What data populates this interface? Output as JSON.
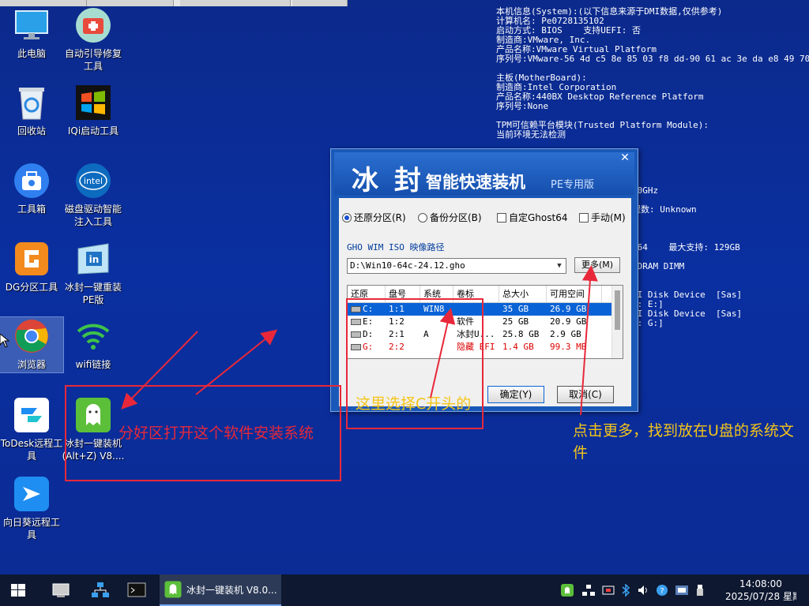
{
  "desktop_icons": [
    {
      "label": "此电脑",
      "icon": "computer-icon"
    },
    {
      "label": "自动引导修复工具",
      "icon": "repair-kit-icon"
    },
    {
      "label": "回收站",
      "icon": "recycle-bin-icon"
    },
    {
      "label": "IQi启动工具",
      "icon": "windows-logo-icon"
    },
    {
      "label": "工具箱",
      "icon": "toolbox-icon"
    },
    {
      "label": "磁盘驱动智能注入工具",
      "icon": "intel-icon"
    },
    {
      "label": "DG分区工具",
      "icon": "diskgenius-icon"
    },
    {
      "label": "冰封一键重装PE版",
      "icon": "reinstall-pe-icon"
    },
    {
      "label": "浏览器",
      "icon": "chrome-icon"
    },
    {
      "label": "wifi链接",
      "icon": "wifi-icon"
    },
    {
      "label": "ToDesk远程工具",
      "icon": "todesk-icon"
    },
    {
      "label": "冰封一键装机(Alt+Z) V8....",
      "icon": "ghost-app-icon"
    },
    {
      "label": "向日葵远程工具",
      "icon": "sunlogin-icon"
    }
  ],
  "sysinfo": {
    "lines": [
      "本机信息(System):(以下信息来源于DMI数据,仅供参考)",
      "计算机名: Pe0728135102",
      "启动方式: BIOS    支持UEFI: 否",
      "制造商:VMware, Inc.",
      "产品名称:VMware Virtual Platform",
      "序列号:VMware-56 4d c5 8e 85 03 f8 dd-90 61 ac 3e da e8 49 70",
      "",
      "主板(MotherBoard):",
      "制造商:Intel Corporation",
      "产品名称:440BX Desktop Reference Platform",
      "序列号:None",
      "",
      "TPM可信赖平台模块(Trusted Platform Module):",
      "当前环境无法检测"
    ],
    "partial_lines": [
      "60GHz",
      "",
      "程数: Unknown",
      "",
      "",
      "",
      " 64    最大支持: 129GB",
      ")",
      " DRAM DIMM",
      "",
      "",
      "SI Disk Device  [Sas]",
      "C: E:]",
      "SI Disk Device  [Sas]",
      "D: G:]"
    ]
  },
  "dialog": {
    "logo_main": "冰 封",
    "logo_sub": "智能快速装机",
    "logo_pe": "PE专用版",
    "close_label": "✕",
    "modes": [
      {
        "label": "还原分区(R)",
        "type": "radio",
        "checked": true
      },
      {
        "label": "备份分区(B)",
        "type": "radio",
        "checked": false
      },
      {
        "label": "自定Ghost64",
        "type": "checkbox",
        "checked": false
      },
      {
        "label": "手动(M)",
        "type": "checkbox",
        "checked": false
      }
    ],
    "path_label": "GHO WIM ISO 映像路径",
    "path_value": "D:\\Win10-64c-24.12.gho",
    "more_button": "更多(M)",
    "table": {
      "headers": [
        "还原",
        "盘号",
        "系统",
        "卷标",
        "总大小",
        "可用空间"
      ],
      "rows": [
        {
          "restore": "C:",
          "disk": "1:1",
          "system": "WIN8",
          "label": "",
          "total": "35 GB",
          "free": "26.9 GB",
          "selected": true,
          "hidden": false
        },
        {
          "restore": "E:",
          "disk": "1:2",
          "system": "",
          "label": "软件",
          "total": "25 GB",
          "free": "20.9 GB",
          "selected": false,
          "hidden": false
        },
        {
          "restore": "D:",
          "disk": "2:1",
          "system": "A",
          "label": "冰封U...",
          "total": "25.8 GB",
          "free": "2.9 GB",
          "selected": false,
          "hidden": false
        },
        {
          "restore": "G:",
          "disk": "2:2",
          "system": "",
          "label": "隐藏 EFI",
          "total": "1.4 GB",
          "free": "99.3 MB",
          "selected": false,
          "hidden": true
        }
      ]
    },
    "ok_button": "确定(Y)",
    "cancel_button": "取消(C)"
  },
  "annotations": {
    "open_software": "分好区打开这个软件安装系统",
    "select_c": "这里选择C开头的",
    "click_more": "点击更多，找到放在U盘的系统文件",
    "annotation_color": "#e8283a",
    "highlight_color": "#f5c518"
  },
  "taskbar": {
    "active_app_label": "冰封一键装机 V8.0...",
    "time": "14:08:00",
    "date": "2025/07/28 星期"
  }
}
